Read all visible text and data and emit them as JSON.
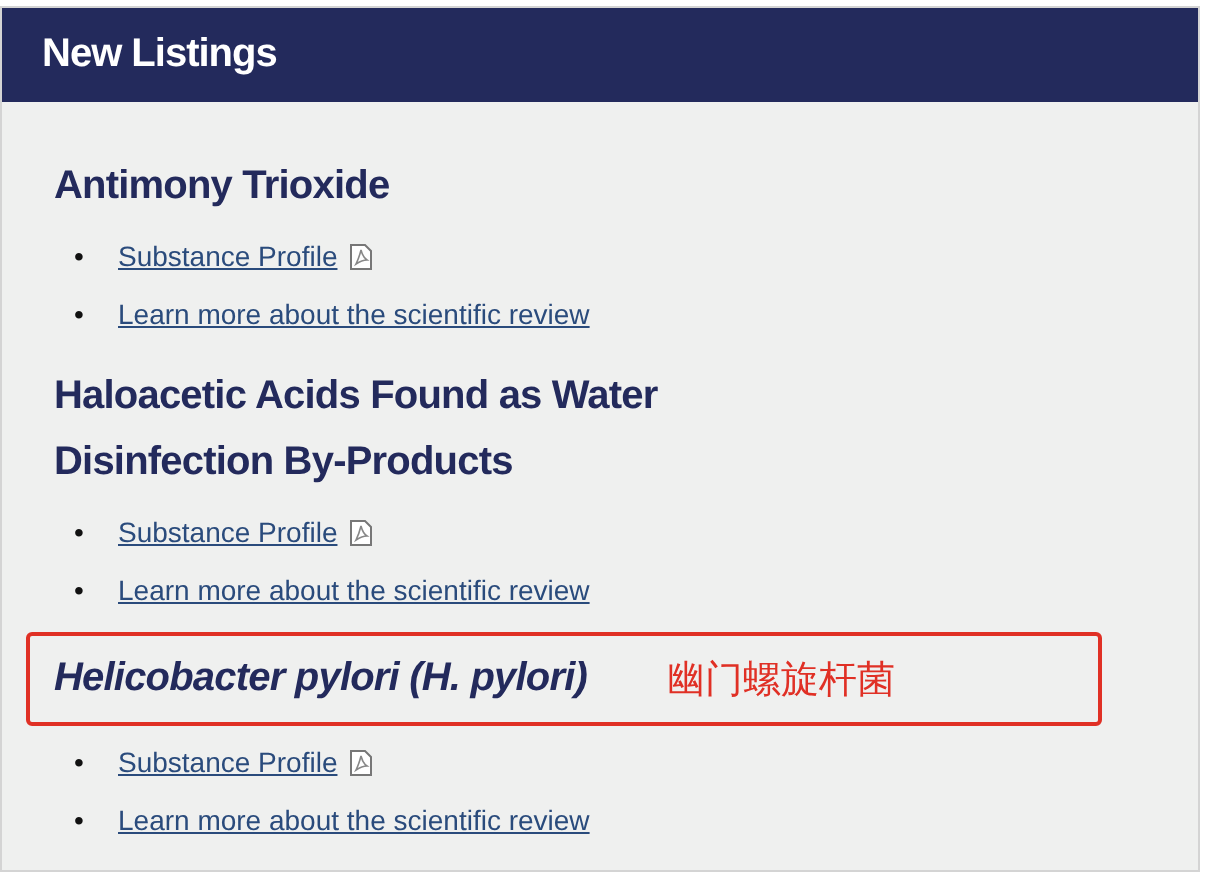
{
  "panel": {
    "title": "New Listings"
  },
  "entries": [
    {
      "title": "Antimony Trioxide",
      "italic": false,
      "links": [
        {
          "kind": "profile",
          "bullet": "•",
          "label": "Substance Profile"
        },
        {
          "kind": "review",
          "bullet": "•",
          "label": "Learn more about the scientific review"
        }
      ]
    },
    {
      "title": "Haloacetic Acids Found as Water Disinfection By-Products",
      "italic": false,
      "links": [
        {
          "kind": "profile",
          "bullet": "•",
          "label": "Substance Profile"
        },
        {
          "kind": "review",
          "bullet": "•",
          "label": "Learn more about the scientific review"
        }
      ]
    },
    {
      "title": "Helicobacter pylori (H. pylori)",
      "italic": true,
      "annotation": {
        "note": "幽门螺旋杆菌"
      },
      "links": [
        {
          "kind": "profile",
          "bullet": "•",
          "label": "Substance Profile"
        },
        {
          "kind": "review",
          "bullet": "•",
          "label": "Learn more about the scientific review"
        }
      ]
    }
  ]
}
